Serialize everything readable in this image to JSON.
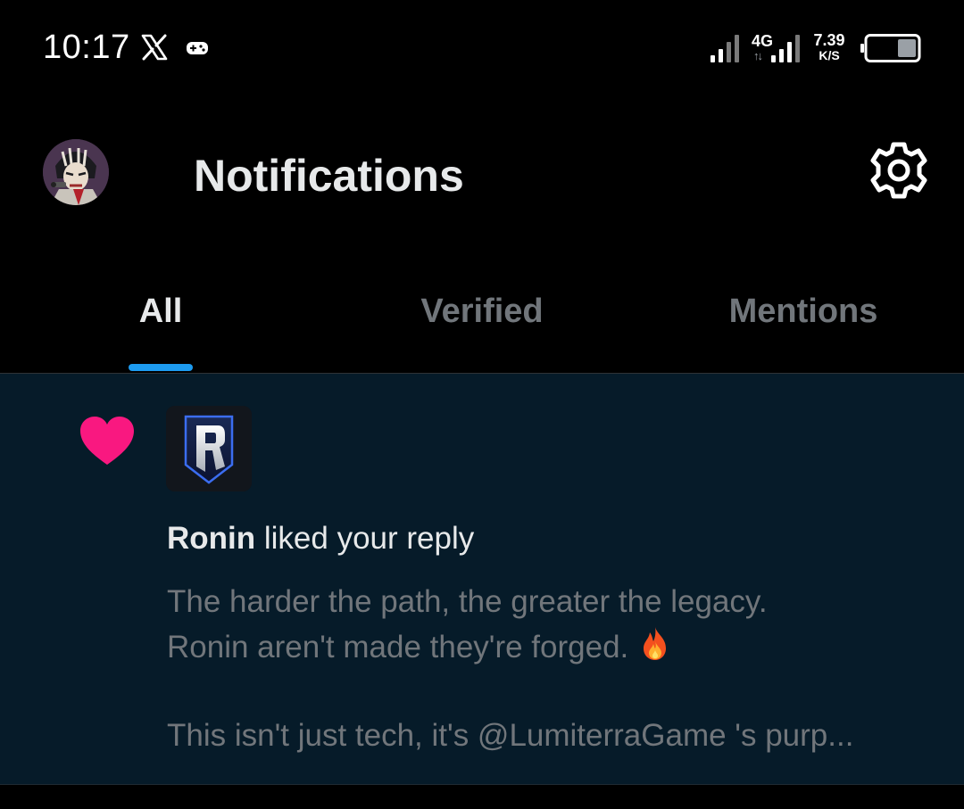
{
  "status_bar": {
    "time": "10:17",
    "network_type": "4G",
    "network_arrows": "↑↓",
    "speed_value": "7.39",
    "speed_unit": "K/S",
    "icons": [
      "x-logo-icon",
      "game-controller-icon",
      "signal-icon",
      "signal-icon",
      "battery-icon"
    ]
  },
  "header": {
    "title": "Notifications",
    "settings_icon": "gear-icon"
  },
  "tabs": [
    {
      "label": "All",
      "active": true
    },
    {
      "label": "Verified",
      "active": false
    },
    {
      "label": "Mentions",
      "active": false
    }
  ],
  "notification": {
    "icon": "heart-icon",
    "user": "Ronin",
    "action": " liked your reply",
    "tweet_lines": [
      "The harder the path, the greater the legacy.",
      "Ronin aren't made they're forged. ",
      "This isn't just tech, it's @LumiterraGame 's purp..."
    ]
  },
  "colors": {
    "background": "#000000",
    "notification_bg": "#061b29",
    "accent": "#1d9bf0",
    "heart": "#f91880",
    "text_primary": "#e7e9ea",
    "text_secondary": "#71767b"
  }
}
